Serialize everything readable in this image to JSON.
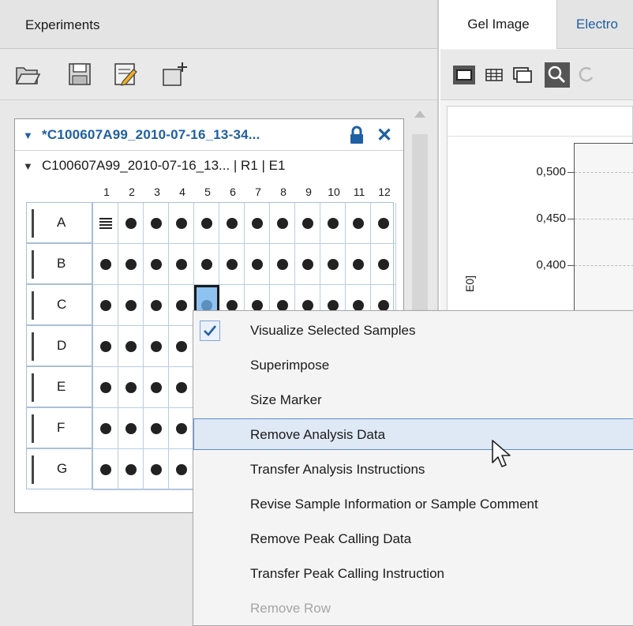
{
  "experiments_panel": {
    "header_title": "Experiments",
    "toolbar": [
      {
        "icon": "open-folder-icon"
      },
      {
        "icon": "save-icon"
      },
      {
        "icon": "edit-icon"
      },
      {
        "icon": "new-experiment-icon"
      }
    ],
    "tree": {
      "experiment_name": "*C100607A99_2010-07-16_13-34...",
      "chip_name": "C100607A99_2010-07-16_13... | R1 | E1"
    },
    "plate": {
      "columns": [
        "1",
        "2",
        "3",
        "4",
        "5",
        "6",
        "7",
        "8",
        "9",
        "10",
        "11",
        "12"
      ],
      "rows": [
        "A",
        "B",
        "C",
        "D",
        "E",
        "F",
        "G"
      ],
      "selected_well": "C5",
      "ladder_well": "A1"
    }
  },
  "right_panel": {
    "tabs": [
      {
        "label": "Gel Image",
        "active": true
      },
      {
        "label": "Electro",
        "active": false
      }
    ],
    "chart": {
      "yticks": [
        "0,500",
        "0,450",
        "0,400"
      ],
      "ylabel_partial": "E0]"
    }
  },
  "context_menu": {
    "items": [
      {
        "label": "Visualize Selected Samples",
        "checked": true,
        "state": "normal"
      },
      {
        "label": "Superimpose",
        "checked": false,
        "state": "normal"
      },
      {
        "label": "Size Marker",
        "checked": false,
        "state": "normal"
      },
      {
        "label": "Remove Analysis Data",
        "checked": false,
        "state": "highlighted"
      },
      {
        "label": "Transfer Analysis Instructions",
        "checked": false,
        "state": "normal"
      },
      {
        "label": "Revise Sample Information or Sample Comment",
        "checked": false,
        "state": "normal"
      },
      {
        "label": "Remove Peak Calling Data",
        "checked": false,
        "state": "normal"
      },
      {
        "label": "Transfer Peak Calling Instruction",
        "checked": false,
        "state": "normal"
      },
      {
        "label": "Remove Row",
        "checked": false,
        "state": "disabled"
      }
    ]
  },
  "colors": {
    "accent_blue": "#1f5fa3",
    "selected_well": "#8ec2f0",
    "menu_highlight": "#dfe9f5",
    "menu_highlight_border": "#5a8ccf"
  }
}
